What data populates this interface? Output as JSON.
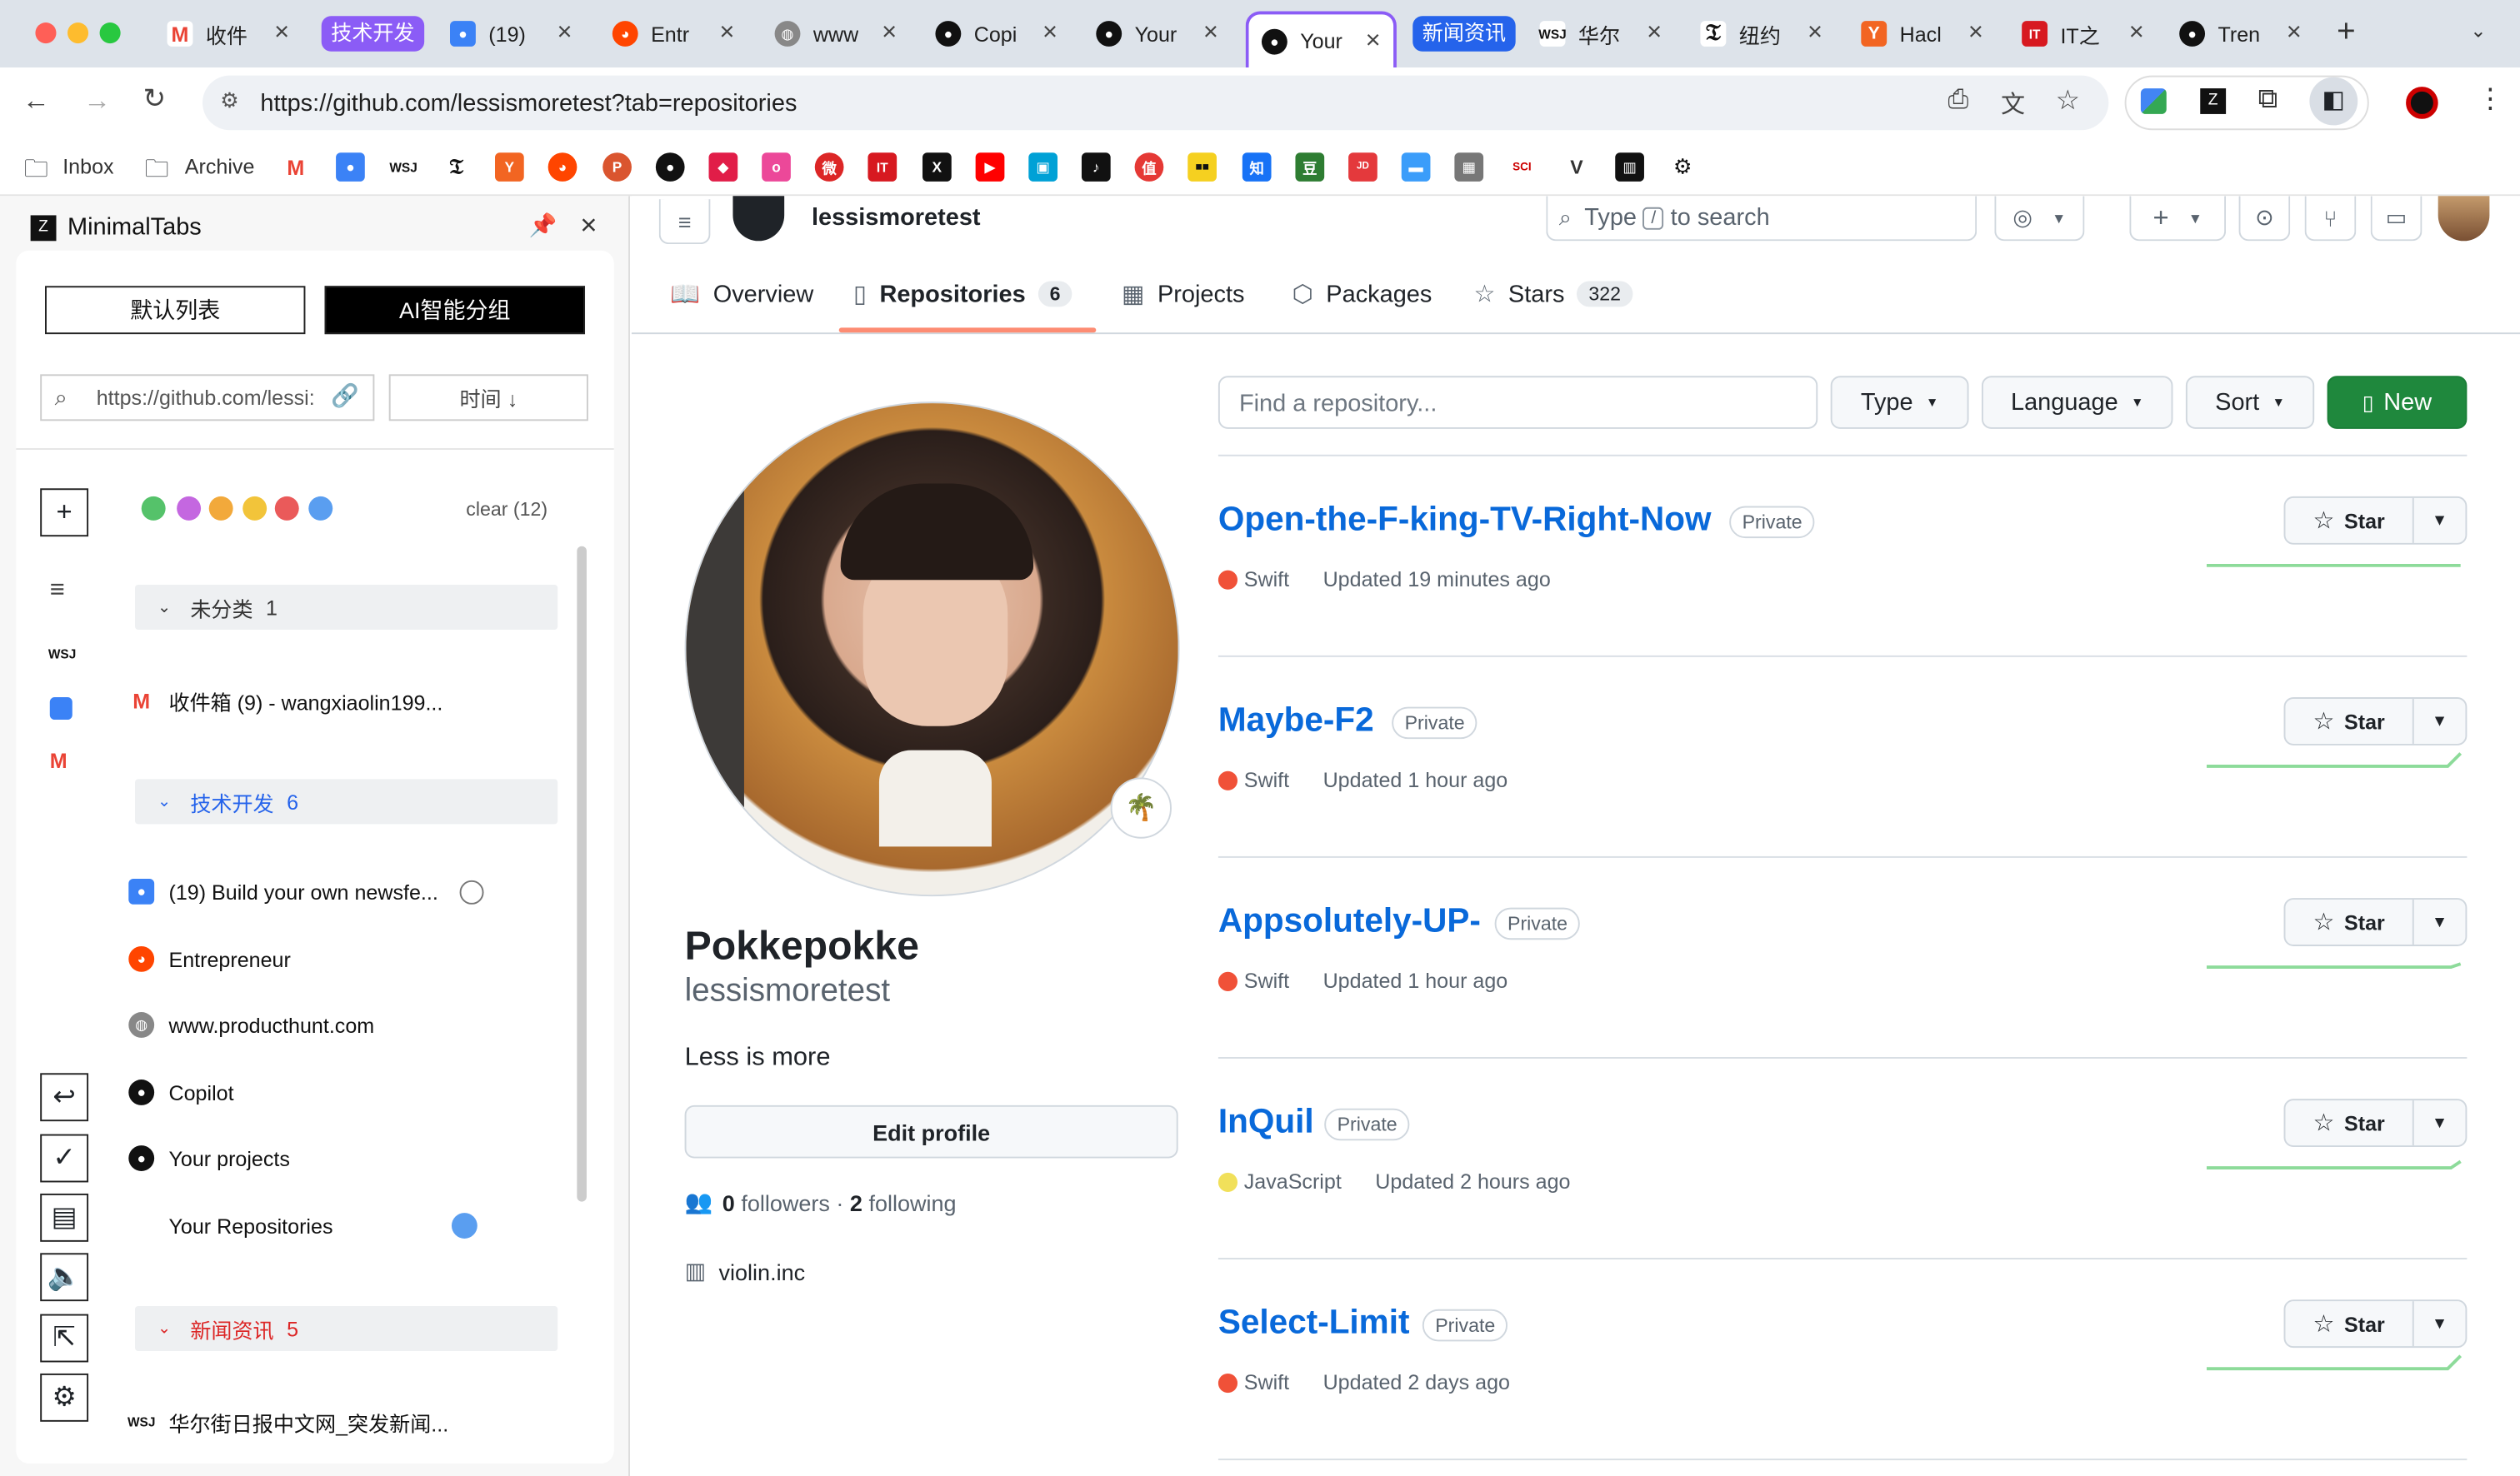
{
  "browser": {
    "tabs": [
      {
        "title": "收件",
        "icon": "gmail-icon"
      },
      {
        "title": "(19)",
        "icon": "feed-icon"
      },
      {
        "title": "Entr",
        "icon": "reddit-icon"
      },
      {
        "title": "www",
        "icon": "globe-icon"
      },
      {
        "title": "Copi",
        "icon": "github-icon"
      },
      {
        "title": "Your",
        "icon": "github-icon"
      },
      {
        "title": "Your",
        "icon": "github-icon"
      },
      {
        "title": "华尔",
        "icon": "wsj-icon"
      },
      {
        "title": "纽约",
        "icon": "nyt-icon"
      },
      {
        "title": "Hacl",
        "icon": "hackernews-icon"
      },
      {
        "title": "IT之",
        "icon": "ithome-icon"
      },
      {
        "title": "Tren",
        "icon": "github-icon"
      }
    ],
    "tab_groups": [
      "技术开发",
      "新闻资讯"
    ],
    "url": "https://github.com/lessismoretest?tab=repositories",
    "bookmarks": {
      "inbox": "Inbox",
      "archive": "Archive"
    }
  },
  "sidebar": {
    "title": "MinimalTabs",
    "btn_default": "默认列表",
    "btn_ai": "AI智能分组",
    "search_value": "https://github.com/lessi:",
    "sort_label": "时间 ↓",
    "clear_label": "clear (12)",
    "colors": [
      "#55c26a",
      "#c467e0",
      "#f2a93b",
      "#f2c43a",
      "#ea5a5a",
      "#5a9ef0"
    ],
    "groups": [
      {
        "name": "未分类",
        "count": "1",
        "color": "#333"
      },
      {
        "name": "技术开发",
        "count": "6",
        "color": "#2563eb"
      },
      {
        "name": "新闻资讯",
        "count": "5",
        "color": "#dc2626"
      }
    ],
    "items": [
      "收件箱 (9) - wangxiaolin199...",
      "(19) Build your own newsfe...",
      "Entrepreneur",
      "www.producthunt.com",
      "Copilot",
      "Your projects",
      "Your Repositories",
      "华尔街日报中文网_突发新闻..."
    ]
  },
  "github": {
    "username": "lessismoretest",
    "search_label_pre": "Type",
    "search_key": "/",
    "search_label_post": "to search",
    "nav": {
      "overview": "Overview",
      "repositories": "Repositories",
      "repo_count": "6",
      "projects": "Projects",
      "packages": "Packages",
      "stars": "Stars",
      "stars_count": "322"
    },
    "profile": {
      "name": "Pokkepokke",
      "login": "lessismoretest",
      "bio": "Less is more",
      "edit": "Edit profile",
      "followers_num": "0",
      "followers_label": "followers",
      "sep": "·",
      "following_num": "2",
      "following_label": "following",
      "org": "violin.inc"
    },
    "filter": {
      "placeholder": "Find a repository...",
      "type": "Type",
      "language": "Language",
      "sort": "Sort",
      "new": "New"
    },
    "repos": [
      {
        "name": "Open-the-F-king-TV-Right-Now",
        "visibility": "Private",
        "language": "Swift",
        "lang_color": "#f05138",
        "updated": "Updated 19 minutes ago",
        "star": "Star"
      },
      {
        "name": "Maybe-F2",
        "visibility": "Private",
        "language": "Swift",
        "lang_color": "#f05138",
        "updated": "Updated 1 hour ago",
        "star": "Star"
      },
      {
        "name": "Appsolutely-UP-",
        "visibility": "Private",
        "language": "Swift",
        "lang_color": "#f05138",
        "updated": "Updated 1 hour ago",
        "star": "Star"
      },
      {
        "name": "InQuil",
        "visibility": "Private",
        "language": "JavaScript",
        "lang_color": "#f1e05a",
        "updated": "Updated 2 hours ago",
        "star": "Star"
      },
      {
        "name": "Select-Limit",
        "visibility": "Private",
        "language": "Swift",
        "lang_color": "#f05138",
        "updated": "Updated 2 days ago",
        "star": "Star"
      }
    ]
  }
}
